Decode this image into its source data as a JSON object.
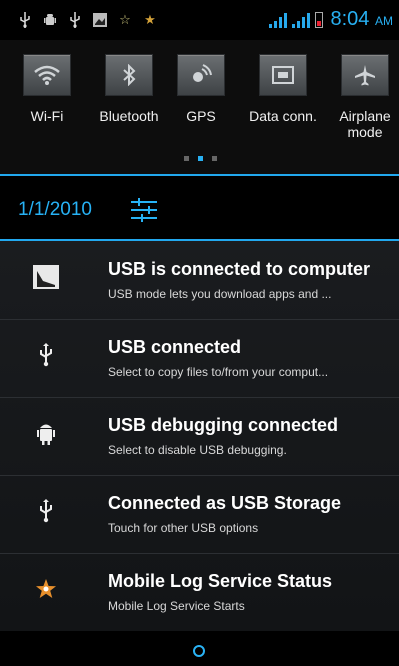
{
  "status_bar": {
    "time": "8:04",
    "ampm": "AM",
    "colors": {
      "accent": "#28b0f2"
    },
    "left_icons": [
      "usb-icon",
      "android-debug-icon",
      "usb-icon",
      "screenshot-icon",
      "star-outline-icon",
      "star-icon"
    ]
  },
  "quick_settings": {
    "tiles": [
      {
        "label": "Wi-Fi",
        "icon": "wifi-icon"
      },
      {
        "label": "Bluetooth",
        "icon": "bluetooth-icon"
      },
      {
        "label": "GPS",
        "icon": "gps-icon"
      },
      {
        "label": "Data conn.",
        "icon": "data-connection-icon"
      },
      {
        "label": "Airplane mode",
        "icon": "airplane-icon"
      }
    ],
    "page_count": 3,
    "active_page": 2
  },
  "date_row": {
    "date": "1/1/2010"
  },
  "notifications": [
    {
      "title": "USB is connected to computer",
      "subtitle": "USB mode lets you download apps and ...",
      "icon": "usb-computer-icon"
    },
    {
      "title": "USB connected",
      "subtitle": "Select to copy files to/from your comput...",
      "icon": "usb-icon"
    },
    {
      "title": "USB debugging connected",
      "subtitle": "Select to disable USB debugging.",
      "icon": "android-debug-icon"
    },
    {
      "title": "Connected as USB Storage",
      "subtitle": "Touch for other USB options",
      "icon": "usb-icon"
    },
    {
      "title": "Mobile Log Service Status",
      "subtitle": "Mobile Log Service Starts",
      "icon": "star-icon"
    }
  ]
}
